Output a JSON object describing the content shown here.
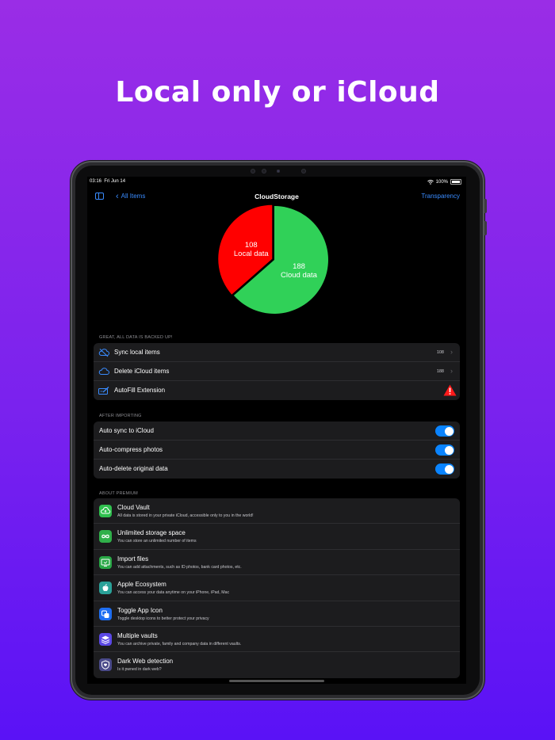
{
  "headline": "Local only or iCloud",
  "status": {
    "time": "03:16",
    "date": "Fri Jun 14",
    "battery": "100%"
  },
  "nav": {
    "back_label": "All Items",
    "title": "CloudStorage",
    "right_label": "Transparency"
  },
  "chart_data": {
    "type": "pie",
    "slices": [
      {
        "name": "Local data",
        "value": 108,
        "color": "#ff0000"
      },
      {
        "name": "Cloud data",
        "value": 188,
        "color": "#30d158"
      }
    ]
  },
  "backup": {
    "header": "GREAT, ALL DATA IS BACKED UP!",
    "rows": [
      {
        "label": "Sync local items",
        "value": "108",
        "icon": "cloud-slash-icon"
      },
      {
        "label": "Delete iCloud items",
        "value": "188",
        "icon": "cloud-icon"
      },
      {
        "label": "AutoFill Extension",
        "value": "",
        "icon": "autofill-icon",
        "status_icon": "warning-icon"
      }
    ]
  },
  "import": {
    "header": "AFTER IMPORTING",
    "rows": [
      {
        "label": "Auto sync to iCloud",
        "on": true
      },
      {
        "label": "Auto-compress photos",
        "on": true
      },
      {
        "label": "Auto-delete original data",
        "on": true
      }
    ]
  },
  "premium": {
    "header": "ABOUT PREMIUM",
    "items": [
      {
        "title": "Cloud Vault",
        "desc": "All data is stored in your private iCloud, accessible only to you in the world!",
        "icon": "cloud-upload-icon",
        "color": "#30c04f"
      },
      {
        "title": "Unlimited storage space",
        "desc": "You can store an unlimited number of items",
        "icon": "infinity-icon",
        "color": "#30b04a"
      },
      {
        "title": "Import files",
        "desc": "You can add attachments, such as ID photos, bank card photos, etc.",
        "icon": "import-icon",
        "color": "#28a745"
      },
      {
        "title": "Apple Ecosystem",
        "desc": "You can access your data anytime on your iPhone, iPad, Mac",
        "icon": "apple-icon",
        "color": "#2aa198"
      },
      {
        "title": "Toggle App Icon",
        "desc": "Toggle desktop icons to better protect your privacy",
        "icon": "app-icon-toggle-icon",
        "color": "#1e6ef2"
      },
      {
        "title": "Multiple vaults",
        "desc": "You can archive private, family and company data in different vaults.",
        "icon": "layers-icon",
        "color": "#5b48e6"
      },
      {
        "title": "Dark Web detection",
        "desc": "Is it pwned in dark web?",
        "icon": "shield-heart-icon",
        "color": "#4a4a8a"
      }
    ]
  }
}
